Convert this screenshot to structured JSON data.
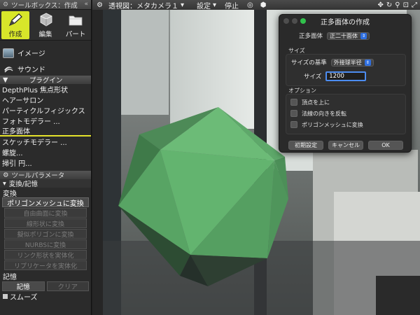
{
  "toolbox": {
    "title": "ツールボックス：作成",
    "collapse": "«",
    "modes": [
      {
        "label": "作成"
      },
      {
        "label": "編集"
      },
      {
        "label": "パート"
      }
    ],
    "items": [
      {
        "label": "イメージ"
      },
      {
        "label": "サウンド"
      }
    ],
    "plugin_header": "プラグイン",
    "plugins": [
      "DepthPlus 焦点形状",
      "ヘアーサロン",
      "パーティクルフィジックス",
      "フォトモデラー ...",
      "正多面体",
      "スケッチモデラー ...",
      "螺旋...",
      "掃引 円..."
    ]
  },
  "tool_params": {
    "title": "ツールパラメータ",
    "section": "変換/記憶",
    "convert_label": "変換",
    "primary_button": "ポリゴンメッシュに変換",
    "disabled_buttons": [
      "自由曲面に変換",
      "線形状に変換",
      "擬似ポリゴンに変換",
      "NURBSに変換",
      "リンク形状を実体化",
      "リプリケータを実体化"
    ],
    "memory_label": "記憶",
    "memory_buttons": [
      "記憶",
      "クリア"
    ],
    "smooth_label": "スムーズ"
  },
  "topbar": {
    "view": "透視図：メタカメラ１",
    "settings": "設定",
    "stop": "停止"
  },
  "dialog": {
    "title": "正多面体の作成",
    "polyhedron_label": "正多面体",
    "polyhedron_value": "正二十面体",
    "size_group": "サイズ",
    "size_basis_label": "サイズの基準",
    "size_basis_value": "外接球半径",
    "size_label": "サイズ",
    "size_value": "1200",
    "options_group": "オプション",
    "options": [
      "頂点を上に",
      "法線の向きを反転",
      "ポリゴンメッシュに変換"
    ],
    "buttons": {
      "reset": "初期設定",
      "cancel": "キャンセル",
      "ok": "OK"
    }
  },
  "colors": {
    "accent_yellow": "#d8e62a",
    "icosahedron_green": "#5fae6e",
    "focus_blue": "#4c8cf0",
    "traffic_green": "#31c24c"
  },
  "icons": {
    "mode_create": "pen-icon",
    "mode_edit": "cube-icon",
    "mode_part": "folder-icon",
    "image": "image-icon",
    "sound": "sound-icon"
  }
}
